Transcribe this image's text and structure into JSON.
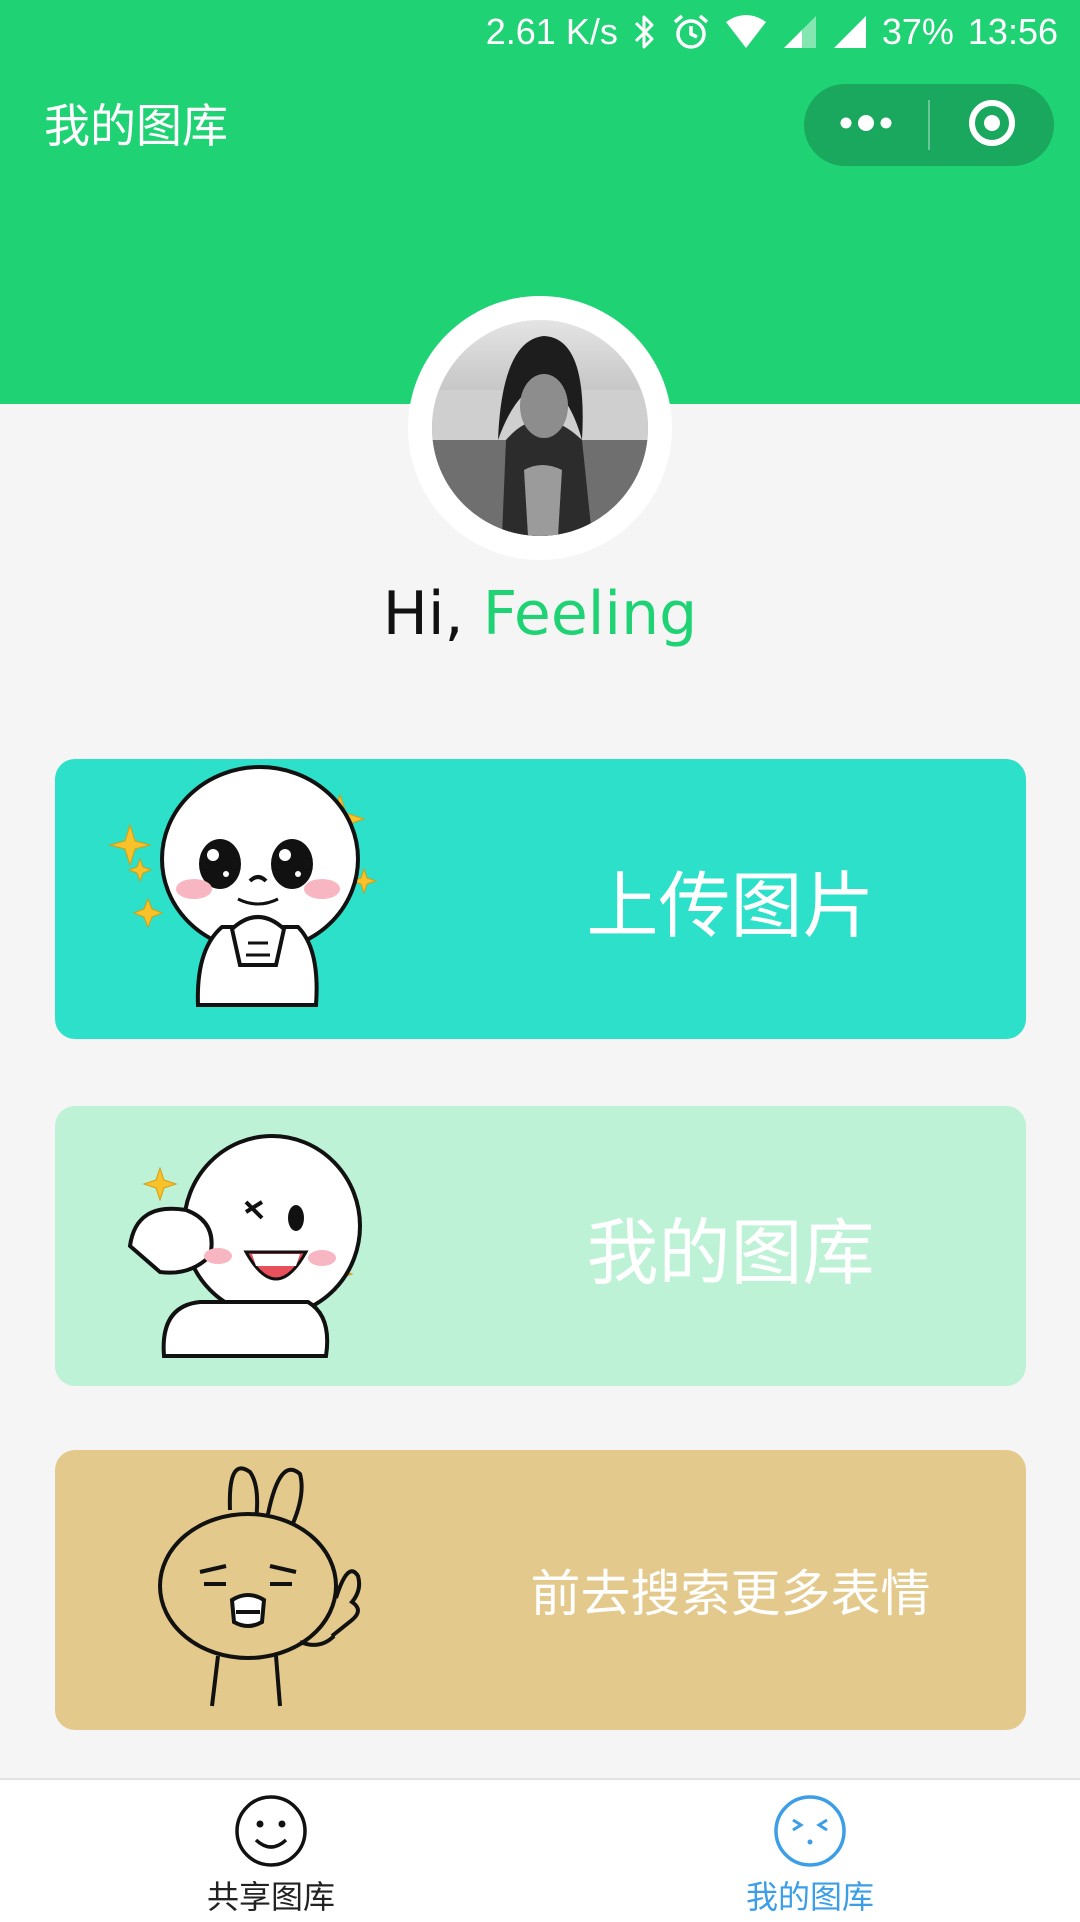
{
  "status_bar": {
    "speed": "2.61 K/s",
    "battery": "37%",
    "time": "13:56",
    "icons": [
      "bluetooth-icon",
      "alarm-icon",
      "wifi-icon",
      "signal-icon",
      "signal-icon"
    ]
  },
  "nav": {
    "title": "我的图库",
    "more_icon": "more-dots-icon",
    "close_icon": "target-icon"
  },
  "profile": {
    "greeting": "Hi, ",
    "name": "Feeling"
  },
  "cards": [
    {
      "label": "上传图片",
      "color": "#2ce0c9",
      "sticker": "moon-pleading-sticker"
    },
    {
      "label": "我的图库",
      "color": "#bdf2d6",
      "sticker": "moon-wink-sticker"
    },
    {
      "label": "前去搜索更多表情",
      "color": "#e3c98b",
      "sticker": "rabbit-shout-sticker"
    }
  ],
  "tabbar": {
    "tabs": [
      {
        "label": "共享图库",
        "icon": "smiley-icon",
        "active": false
      },
      {
        "label": "我的图库",
        "icon": "wink-face-icon",
        "active": true
      }
    ]
  },
  "colors": {
    "brand_green": "#1fd374",
    "active_tab": "#3d9ee8",
    "background": "#f5f5f5"
  }
}
